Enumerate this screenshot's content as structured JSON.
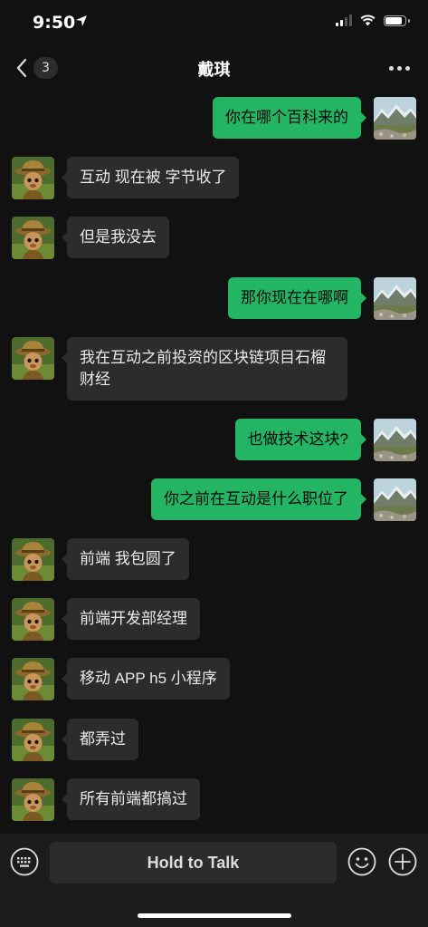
{
  "status_bar": {
    "time": "9:50"
  },
  "nav": {
    "back_count": "3",
    "title": "戴琪"
  },
  "messages": [
    {
      "side": "out",
      "text": "你在哪个百科来的"
    },
    {
      "side": "in",
      "text": "互动 现在被 字节收了"
    },
    {
      "side": "in",
      "text": "但是我没去"
    },
    {
      "side": "out",
      "text": "那你现在在哪啊"
    },
    {
      "side": "in",
      "text": "我在互动之前投资的区块链项目石榴财经"
    },
    {
      "side": "out",
      "text": "也做技术这块?"
    },
    {
      "side": "out",
      "text": "你之前在互动是什么职位了"
    },
    {
      "side": "in",
      "text": "前端 我包圆了"
    },
    {
      "side": "in",
      "text": "前端开发部经理"
    },
    {
      "side": "in",
      "text": "移动 APP h5 小程序"
    },
    {
      "side": "in",
      "text": "都弄过"
    },
    {
      "side": "in",
      "text": "所有前端都搞过"
    }
  ],
  "input": {
    "hold_label": "Hold to Talk"
  },
  "icons": {
    "back": "chevron-left-icon",
    "more": "more-dots-icon",
    "keyboard": "keyboard-icon",
    "emoji": "emoji-icon",
    "add": "plus-icon"
  },
  "colors": {
    "outgoing_bubble": "#24b564",
    "incoming_bubble": "#2c2c2c",
    "background": "#111111"
  }
}
